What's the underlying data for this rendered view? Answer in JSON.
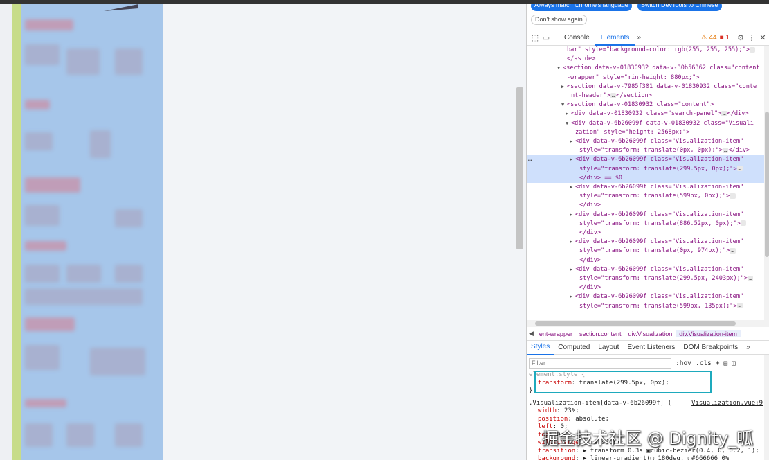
{
  "infobar": {
    "match_language": "Always match Chrome's language",
    "switch_language": "Switch DevTools to Chinese",
    "dont_show": "Don't show again"
  },
  "tabs": {
    "console": "Console",
    "elements": "Elements",
    "more": "»",
    "warnings": "44",
    "errors": "1"
  },
  "dom_lines": [
    {
      "indent": 6,
      "tri": "",
      "text": "bar\" style=\"background-color: rgb(255, 255, 255);\">",
      "dots": true
    },
    {
      "indent": 6,
      "tri": "",
      "text": "</aside>",
      "dots": false
    },
    {
      "indent": 5,
      "tri": "▼",
      "text": "<section data-v-01830932 data-v-30b56362 class=\"content",
      "dots": false
    },
    {
      "indent": 6,
      "tri": "",
      "text": "-wrapper\" style=\"min-height: 880px;\">",
      "dots": false
    },
    {
      "indent": 6,
      "tri": "▶",
      "text": "<section data-v-7985f301 data-v-01830932 class=\"conte",
      "dots": false
    },
    {
      "indent": 7,
      "tri": "",
      "text": "nt-header\">",
      "dots": true,
      "after": "</section>"
    },
    {
      "indent": 6,
      "tri": "▼",
      "text": "<section data-v-01830932 class=\"content\">",
      "dots": false
    },
    {
      "indent": 7,
      "tri": "▶",
      "text": "<div data-v-01830932 class=\"search-panel\">",
      "dots": true,
      "after": "</div>"
    },
    {
      "indent": 7,
      "tri": "▼",
      "text": "<div data-v-6b26099f data-v-01830932 class=\"Visuali",
      "dots": false
    },
    {
      "indent": 8,
      "tri": "",
      "text": "zation\" style=\"height: 2568px;\">",
      "dots": false
    },
    {
      "indent": 8,
      "tri": "▶",
      "text": "<div data-v-6b26099f class=\"Visualization-item\"",
      "dots": false
    },
    {
      "indent": 9,
      "tri": "",
      "text": "style=\"transform: translate(0px, 0px);\">",
      "dots": true,
      "after": "</div>"
    },
    {
      "indent": 8,
      "tri": "▶",
      "text": "<div data-v-6b26099f class=\"Visualization-item\"",
      "dots": false,
      "sel": true
    },
    {
      "indent": 9,
      "tri": "",
      "text": "style=\"transform: translate(299.5px, 0px);\">",
      "dots": true,
      "sel": true
    },
    {
      "indent": 9,
      "tri": "",
      "text": "</div> == $0",
      "dots": false,
      "sel": true
    },
    {
      "indent": 8,
      "tri": "▶",
      "text": "<div data-v-6b26099f class=\"Visualization-item\"",
      "dots": false
    },
    {
      "indent": 9,
      "tri": "",
      "text": "style=\"transform: translate(599px, 0px);\">",
      "dots": true
    },
    {
      "indent": 9,
      "tri": "",
      "text": "</div>",
      "dots": false
    },
    {
      "indent": 8,
      "tri": "▶",
      "text": "<div data-v-6b26099f class=\"Visualization-item\"",
      "dots": false
    },
    {
      "indent": 9,
      "tri": "",
      "text": "style=\"transform: translate(886.52px, 0px);\">",
      "dots": true
    },
    {
      "indent": 9,
      "tri": "",
      "text": "</div>",
      "dots": false
    },
    {
      "indent": 8,
      "tri": "▶",
      "text": "<div data-v-6b26099f class=\"Visualization-item\"",
      "dots": false
    },
    {
      "indent": 9,
      "tri": "",
      "text": "style=\"transform: translate(0px, 974px);\">",
      "dots": true
    },
    {
      "indent": 9,
      "tri": "",
      "text": "</div>",
      "dots": false
    },
    {
      "indent": 8,
      "tri": "▶",
      "text": "<div data-v-6b26099f class=\"Visualization-item\"",
      "dots": false
    },
    {
      "indent": 9,
      "tri": "",
      "text": "style=\"transform: translate(299.5px, 2403px);\">",
      "dots": true
    },
    {
      "indent": 9,
      "tri": "",
      "text": "</div>",
      "dots": false
    },
    {
      "indent": 8,
      "tri": "▶",
      "text": "<div data-v-6b26099f class=\"Visualization-item\"",
      "dots": false
    },
    {
      "indent": 9,
      "tri": "",
      "text": "style=\"transform: translate(599px, 135px);\">",
      "dots": true
    }
  ],
  "breadcrumbs": [
    "ent-wrapper",
    "section.content",
    "div.Visualization",
    "div.Visualization-item"
  ],
  "styles_tabs": [
    "Styles",
    "Computed",
    "Layout",
    "Event Listeners",
    "DOM Breakpoints",
    "»"
  ],
  "filter": {
    "placeholder": "Filter",
    "hov": ":hov",
    "cls": ".cls"
  },
  "styles": {
    "element_style": "element.style {",
    "el_prop": "transform",
    "el_val": "translate(299.5px, 0px);",
    "close": "}",
    "rule_selector": ".Visualization-item[data-v-6b26099f] {",
    "rule_source": "Visualization.vue:9",
    "decls": [
      {
        "p": "width",
        "v": "23%;"
      },
      {
        "p": "position",
        "v": "absolute;"
      },
      {
        "p": "left",
        "v": "0;"
      },
      {
        "p": "top",
        "v": "0;"
      },
      {
        "p": "will-change",
        "v": "transform;"
      },
      {
        "p": "transition",
        "v": "▶ transform 0.3s ▣cubic-bezier(0.4, 0, 0.2, 1);"
      },
      {
        "p": "background",
        "v": "▶ linear-gradient(▢ 180deg, ▢#666666 0%"
      }
    ]
  },
  "watermark": "掘金技术社区 @ Dignity_呱"
}
